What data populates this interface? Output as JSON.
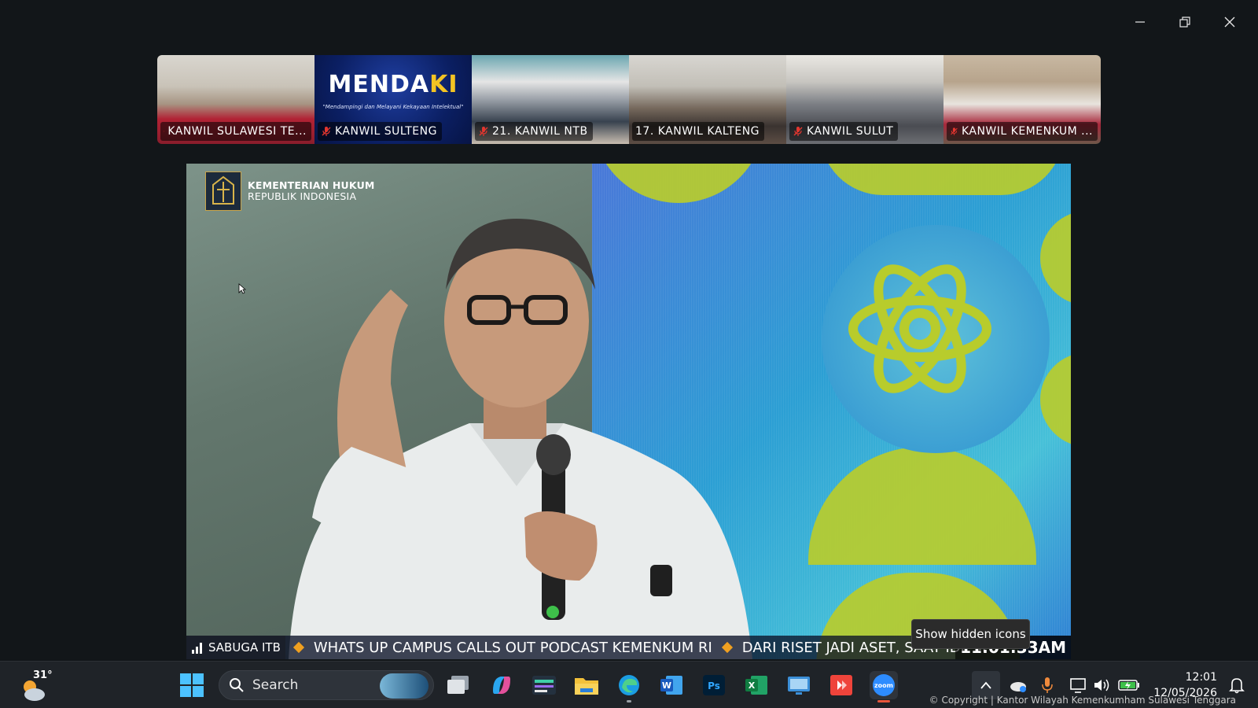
{
  "window": {
    "minimize_label": "—",
    "restore_label": "❐",
    "close_label": "✕"
  },
  "participants": [
    {
      "name": "KANWIL SULAWESI TE...",
      "muted": true
    },
    {
      "name": "KANWIL SULTENG",
      "muted": true
    },
    {
      "name": "21. KANWIL NTB",
      "muted": true
    },
    {
      "name": "17. KANWIL KALTENG",
      "muted": false
    },
    {
      "name": "KANWIL SULUT",
      "muted": true
    },
    {
      "name": "KANWIL KEMENKUM ...",
      "muted": true
    }
  ],
  "mendaki": {
    "title_main": "MENDA",
    "title_accent": "KI",
    "subtitle": "\"Mendampingi dan Melayani Kekayaan Intelektual\""
  },
  "main_video": {
    "logo_title": "KEMENTERIAN HUKUM",
    "logo_subtitle": "REPUBLIK INDONESIA",
    "ticker_source": "SABUGA ITB",
    "ticker_items": [
      "WHATS UP CAMPUS CALLS OUT PODCAST KEMENKUM RI",
      "DARI RISET JADI ASET, SAAT IDE M"
    ],
    "ticker_time": "11:01:33AM"
  },
  "tooltip": "Show hidden icons",
  "taskbar": {
    "weather_temp": "31°",
    "search_label": "Search",
    "clock_time": "12:01",
    "clock_date": "12/05/2026"
  },
  "copyright": "© Copyright | Kantor Wilayah Kemenkumham Sulawesi Tenggara",
  "colors": {
    "accent_yellow": "#f4c423",
    "ticker_diamond": "#f0a020",
    "muted_red": "#e2362f",
    "taskbar_bg": "#1f2328"
  }
}
